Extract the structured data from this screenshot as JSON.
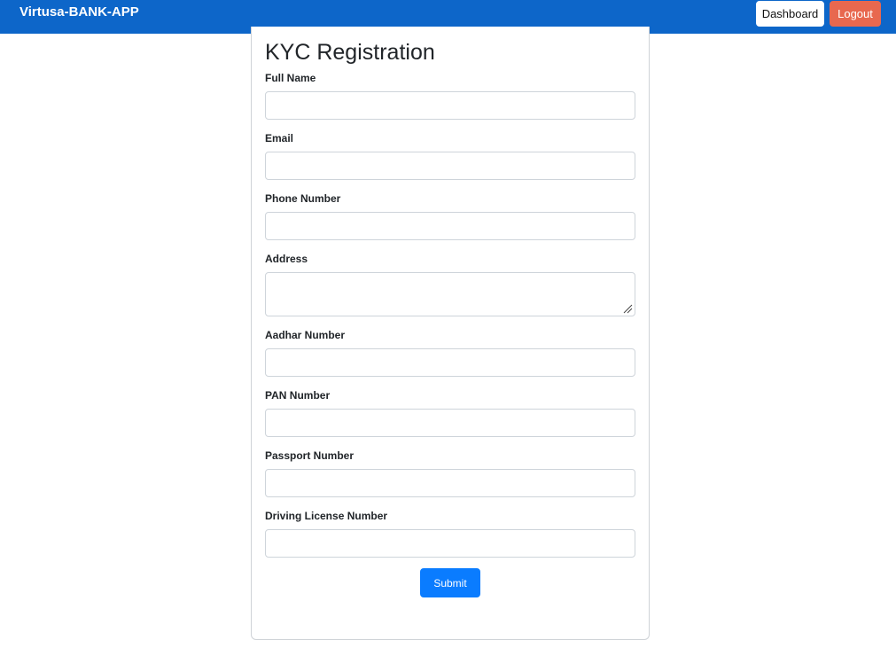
{
  "header": {
    "brand": "Virtusa-BANK-APP",
    "dashboard_label": "Dashboard",
    "logout_label": "Logout"
  },
  "form": {
    "title": "KYC Registration",
    "fields": [
      {
        "label": "Full Name",
        "value": ""
      },
      {
        "label": "Email",
        "value": ""
      },
      {
        "label": "Phone Number",
        "value": ""
      },
      {
        "label": "Address",
        "value": ""
      },
      {
        "label": "Aadhar Number",
        "value": ""
      },
      {
        "label": "PAN Number",
        "value": ""
      },
      {
        "label": "Passport Number",
        "value": ""
      },
      {
        "label": "Driving License Number",
        "value": ""
      }
    ],
    "submit_label": "Submit"
  },
  "colors": {
    "navbar": "#0d66c9",
    "logout": "#e8684f",
    "submit": "#0a7cff"
  }
}
